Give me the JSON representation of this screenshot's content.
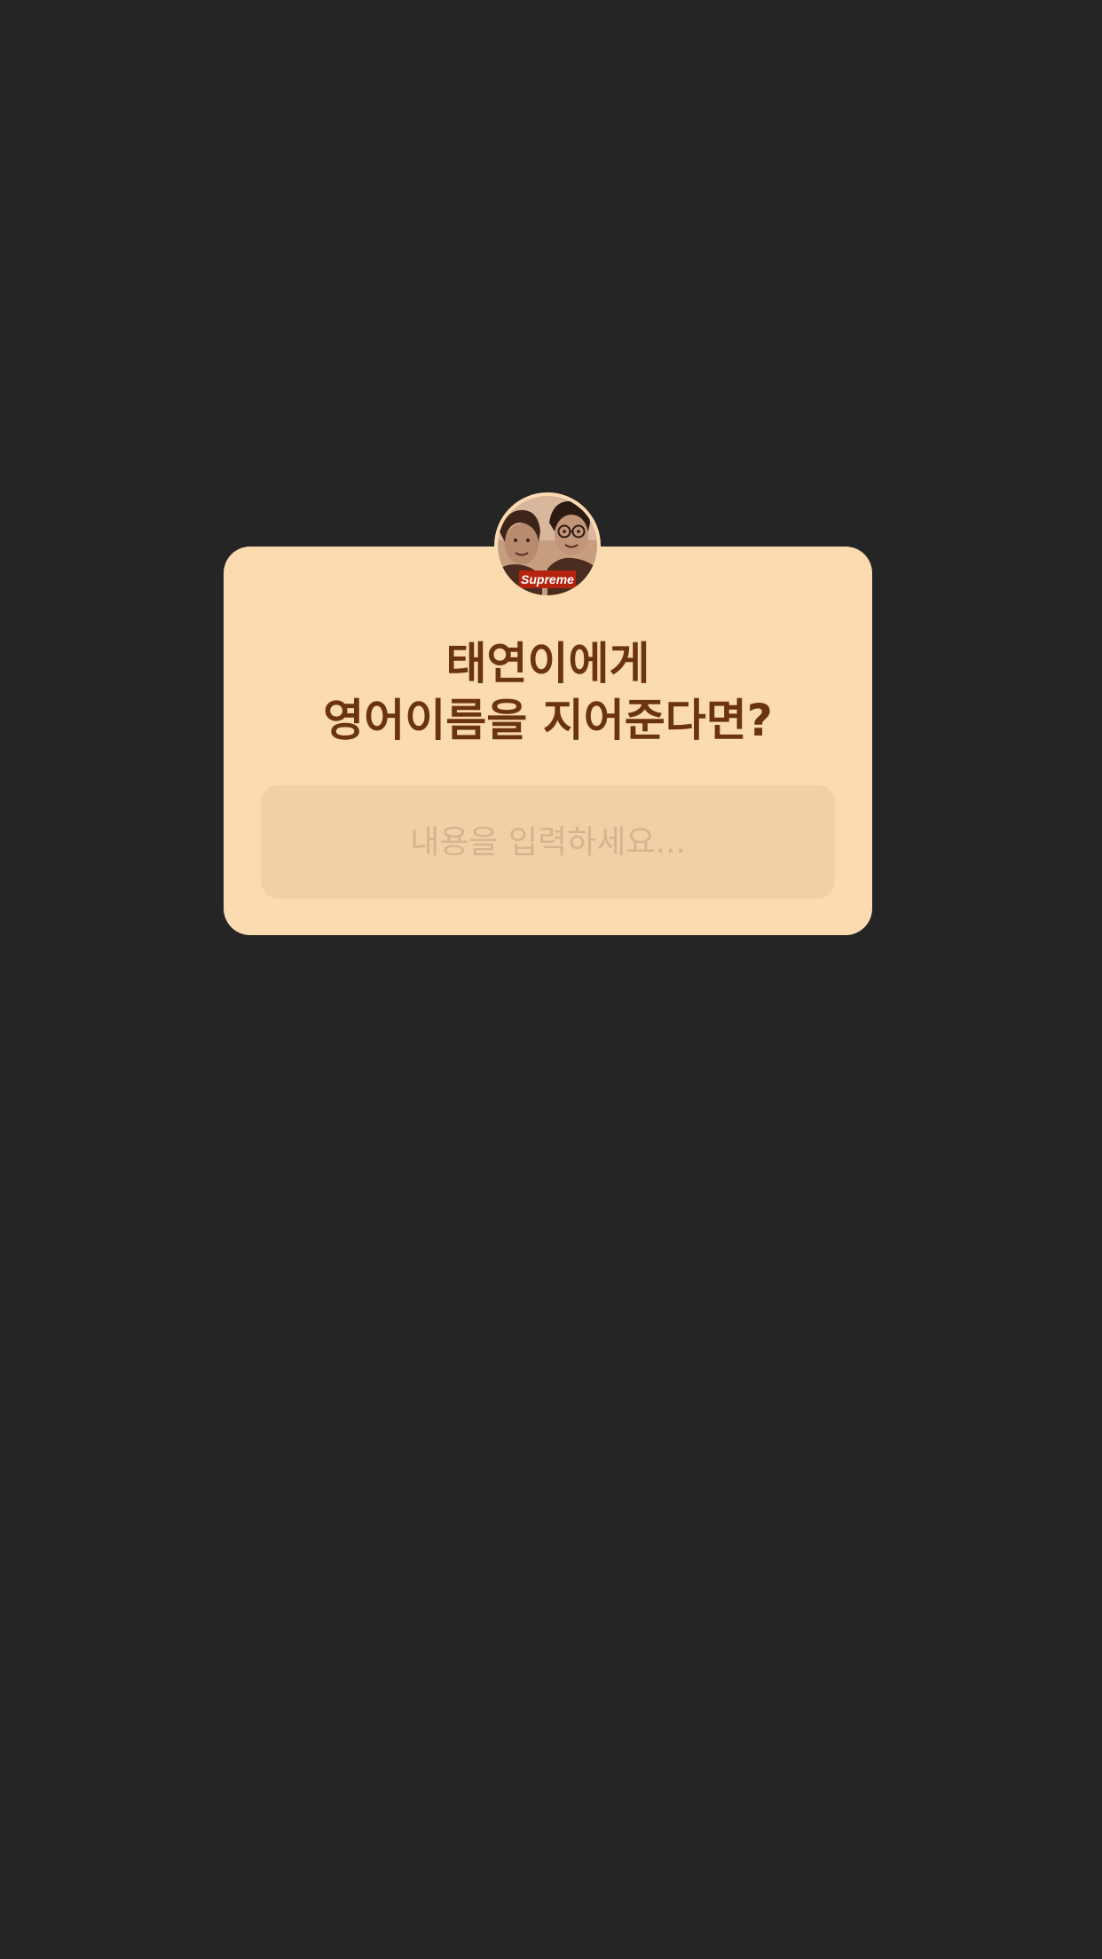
{
  "question_sticker": {
    "title_line_1": "태연이에게",
    "title_line_2": "영어이름을 지어준다면?",
    "answer_placeholder": "내용을 입력하세요...",
    "answer_value": "",
    "avatar_logo_text": "Supreme"
  },
  "colors": {
    "background": "#252525",
    "card": "#fddbb1",
    "title_text": "#6b3410",
    "input_field": "#f2d0a7",
    "placeholder": "#d8b38d",
    "logo_box": "#b3230e"
  }
}
